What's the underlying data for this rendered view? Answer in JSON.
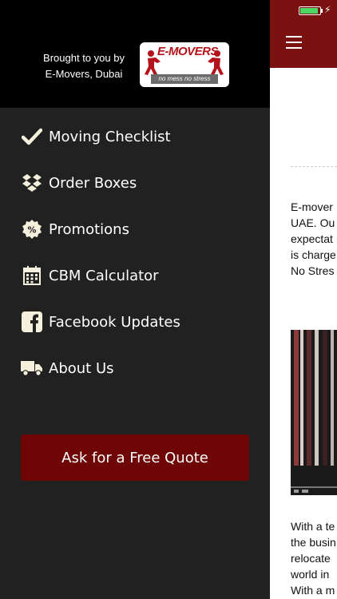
{
  "drawer": {
    "brought_by_line1": "Brought to you by",
    "brought_by_line2": "E-Movers, Dubai",
    "logo": {
      "brand": "E-MOVERS",
      "tagline": "no mess no stress"
    },
    "menu": [
      {
        "label": "Moving Checklist",
        "icon": "checkmark-icon"
      },
      {
        "label": "Order Boxes",
        "icon": "dropbox-icon"
      },
      {
        "label": "Promotions",
        "icon": "percent-badge-icon"
      },
      {
        "label": "CBM Calculator",
        "icon": "calendar-icon"
      },
      {
        "label": "Facebook Updates",
        "icon": "facebook-icon"
      },
      {
        "label": "About Us",
        "icon": "truck-icon"
      }
    ],
    "quote_button": "Ask for a Free Quote"
  },
  "main": {
    "para1": [
      "E-mover",
      "UAE. Ou",
      "expectat",
      "is charge",
      "No Stres"
    ],
    "para2": [
      "With a te",
      "the busin",
      "relocate",
      "world in",
      "With a m"
    ]
  },
  "colors": {
    "drawer_bg": "#212121",
    "header_bg": "#000000",
    "brand_red": "#7a1212",
    "button_red": "#6e0606",
    "battery_green": "#4cd964"
  },
  "status": {
    "battery_level": 0.9
  }
}
